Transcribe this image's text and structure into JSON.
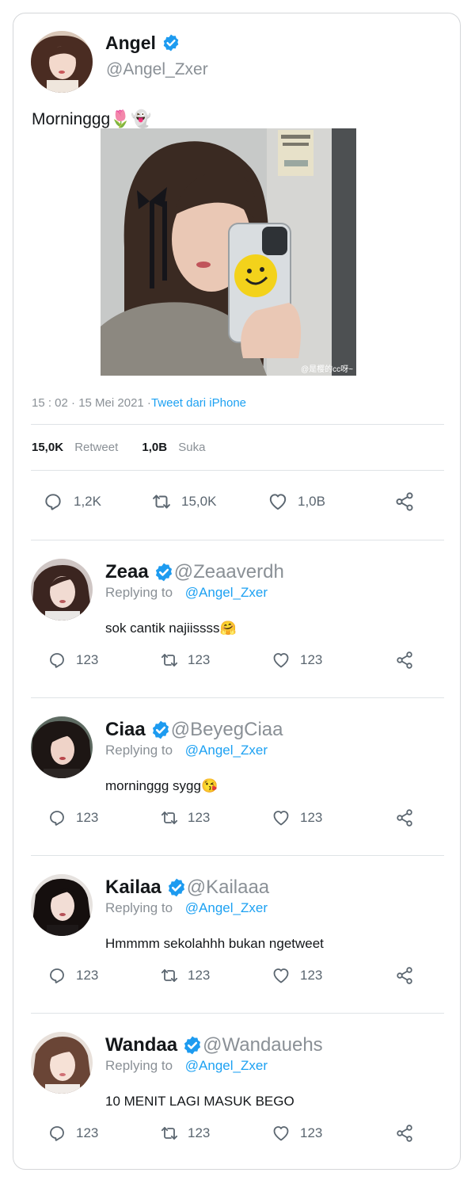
{
  "main": {
    "name": "Angel",
    "handle": "@Angel_Zxer",
    "text": "Morninggg🌷👻",
    "timestamp": "15 : 02 · 15 Mei 2021 ·",
    "source": "Tweet dari iPhone",
    "stats": {
      "retweets": "15,0K",
      "retweets_label": "Retweet",
      "likes": "1,0B",
      "likes_label": "Suka"
    },
    "actions": {
      "replies": "1,2K",
      "retweets": "15,0K",
      "likes": "1,0B"
    },
    "photo_watermark": "@是樱的cc呀~"
  },
  "replying_label": "Replying to",
  "replies": [
    {
      "name": "Zeaa",
      "handle": "@Zeaaverdh",
      "to": "@Angel_Zxer",
      "text": "sok cantik najiissss🤗",
      "reply_count": "123",
      "retweet_count": "123",
      "like_count": "123"
    },
    {
      "name": "Ciaa",
      "handle": "@BeyegCiaa",
      "to": "@Angel_Zxer",
      "text": "morninggg sygg😘",
      "reply_count": "123",
      "retweet_count": "123",
      "like_count": "123"
    },
    {
      "name": "Kailaa",
      "handle": "@Kailaaa",
      "to": "@Angel_Zxer",
      "text": "Hmmmm sekolahhh bukan ngetweet",
      "reply_count": "123",
      "retweet_count": "123",
      "like_count": "123"
    },
    {
      "name": "Wandaa",
      "handle": "@Wandauehs",
      "to": "@Angel_Zxer",
      "text": "10 MENIT LAGI MASUK BEGO",
      "reply_count": "123",
      "retweet_count": "123",
      "like_count": "123"
    }
  ],
  "colors": {
    "accent": "#1da1f2",
    "verified": "#1d9bf0",
    "muted": "#8a9096",
    "border": "#d4d6d9"
  }
}
